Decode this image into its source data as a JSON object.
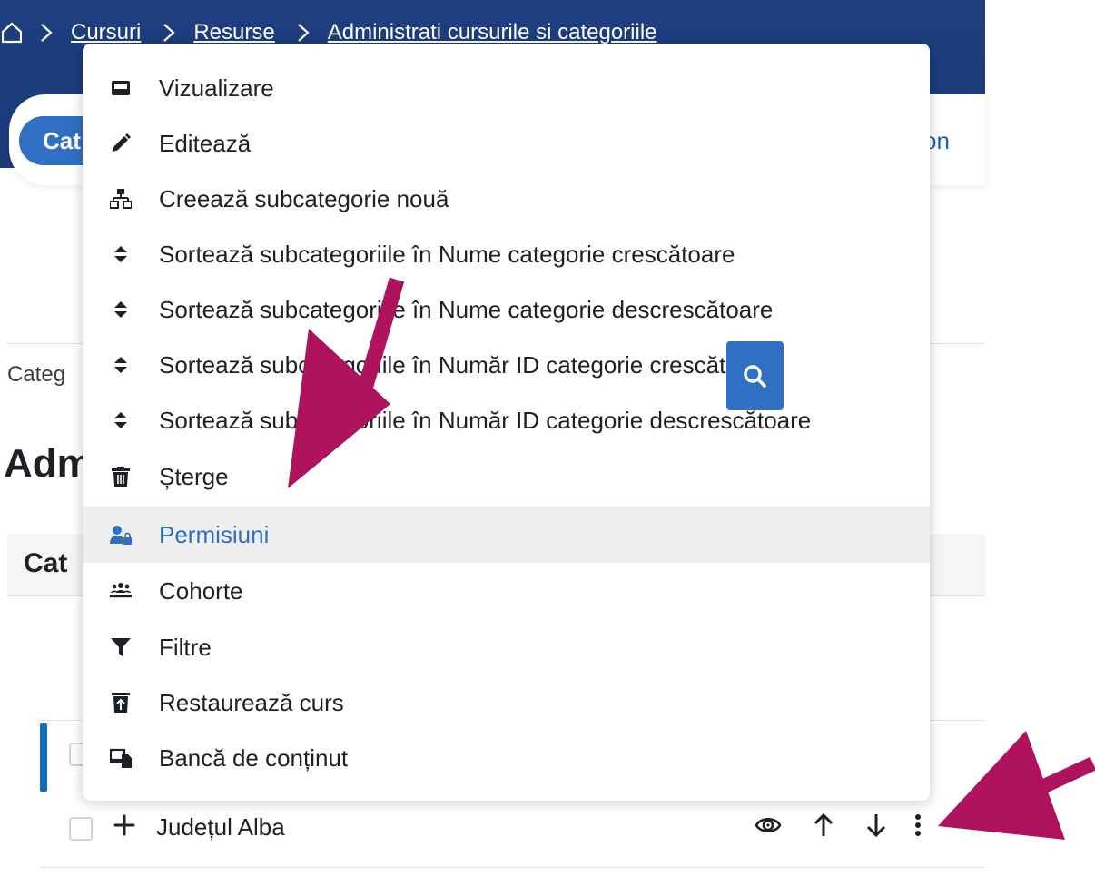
{
  "breadcrumb": {
    "items": [
      "Cursuri",
      "Resurse",
      "Administrati cursurile si categoriile"
    ]
  },
  "tabs": {
    "active_label": "Cat",
    "right_label": "on"
  },
  "page": {
    "category_selector_label": "Categ",
    "heading": "Adm",
    "section_title": "Cat"
  },
  "list": {
    "row_name": "Județul Alba"
  },
  "menu": {
    "items": [
      {
        "label": "Vizualizare",
        "icon": "display-icon"
      },
      {
        "label": "Editează",
        "icon": "pencil-icon"
      },
      {
        "label": "Creează subcategorie nouă",
        "icon": "sitemap-icon"
      },
      {
        "label": "Sortează subcategoriile în Nume categorie crescătoare",
        "icon": "sort-icon"
      },
      {
        "label": "Sortează subcategoriile în Nume categorie descrescătoare",
        "icon": "sort-icon"
      },
      {
        "label": "Sortează subcategoriile în Număr ID categorie crescătoare",
        "icon": "sort-icon"
      },
      {
        "label": "Sortează subcategoriile în Număr ID categorie descrescătoare",
        "icon": "sort-icon"
      },
      {
        "label": "Șterge",
        "icon": "trash-icon"
      },
      {
        "label": "Permisiuni",
        "icon": "user-lock-icon",
        "active": true
      },
      {
        "label": "Cohorte",
        "icon": "users-icon"
      },
      {
        "label": "Filtre",
        "icon": "filter-icon"
      },
      {
        "label": "Restaurează curs",
        "icon": "trash-restore-icon"
      },
      {
        "label": "Bancă de conținut",
        "icon": "content-bank-icon"
      }
    ]
  },
  "colors": {
    "header_blue": "#1e3e80",
    "accent_blue": "#2f6fc4",
    "annotation_arrow": "#b0135e"
  }
}
